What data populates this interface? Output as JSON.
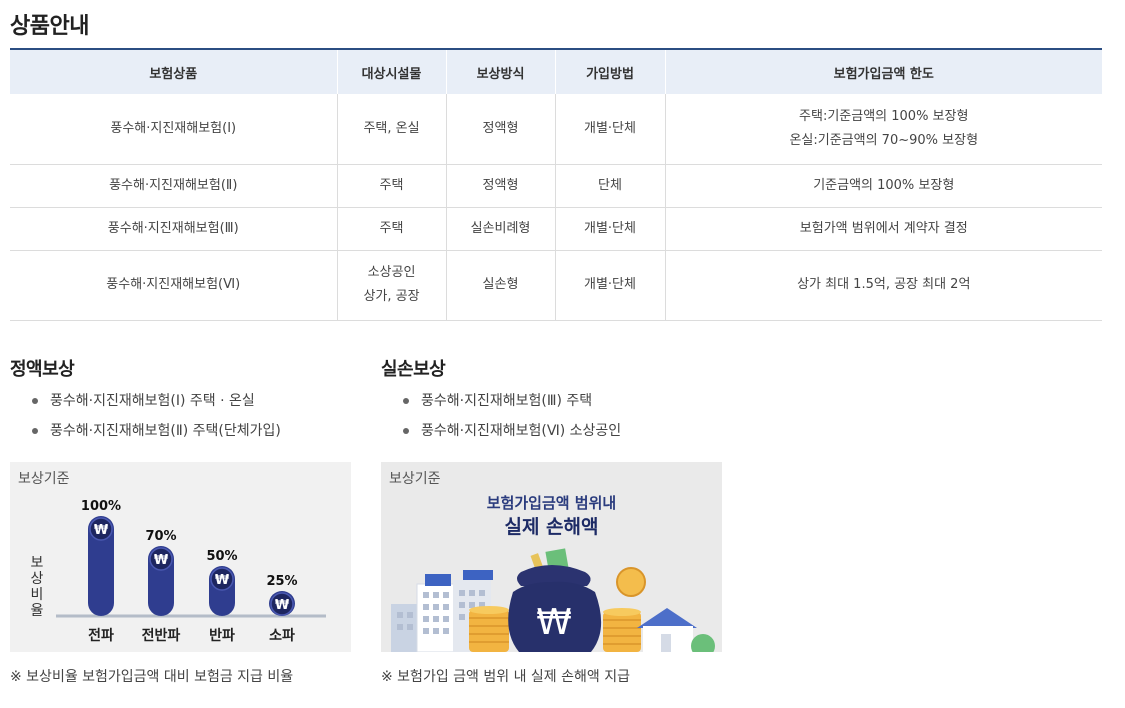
{
  "page": {
    "title": "상품안내"
  },
  "table": {
    "headers": [
      "보험상품",
      "대상시설물",
      "보상방식",
      "가입방법",
      "보험가입금액 한도"
    ],
    "rows": [
      {
        "product": "풍수해·지진재해보험(Ⅰ)",
        "facility": [
          "주택, 온실"
        ],
        "method": "정액형",
        "join": "개별·단체",
        "limit": [
          "주택:기준금액의 100% 보장형",
          "온실:기준금액의 70~90% 보장형"
        ]
      },
      {
        "product": "풍수해·지진재해보험(Ⅱ)",
        "facility": [
          "주택"
        ],
        "method": "정액형",
        "join": "단체",
        "limit": [
          "기준금액의 100% 보장형"
        ]
      },
      {
        "product": "풍수해·지진재해보험(Ⅲ)",
        "facility": [
          "주택"
        ],
        "method": "실손비례형",
        "join": "개별·단체",
        "limit": [
          "보험가액 범위에서 계약자 결정"
        ]
      },
      {
        "product": "풍수해·지진재해보험(Ⅵ)",
        "facility": [
          "소상공인",
          "상가, 공장"
        ],
        "method": "실손형",
        "join": "개별·단체",
        "limit": [
          "상가 최대 1.5억, 공장 최대 2억"
        ]
      }
    ]
  },
  "fixed": {
    "heading": "정액보상",
    "items": [
      "풍수해·지진재해보험(Ⅰ) 주택 · 온실",
      "풍수해·지진재해보험(Ⅱ) 주택(단체가입)"
    ],
    "panel_label": "보상기준",
    "footnote": "※ 보상비율 보험가입금액 대비 보험금 지급 비율",
    "currency_symbol": "₩"
  },
  "actual": {
    "heading": "실손보상",
    "items": [
      "풍수해·지진재해보험(Ⅲ) 주택",
      "풍수해·지진재해보험(Ⅵ) 소상공인"
    ],
    "panel_label": "보상기준",
    "title_line1": "보험가입금액 범위내",
    "title_line2": "실제 손해액",
    "bag_symbol": "₩",
    "footnote": "※ 보험가입 금액 범위 내 실제 손해액 지급"
  },
  "chart_data": {
    "type": "bar",
    "ylabel": "보상비율",
    "categories": [
      "전파",
      "전반파",
      "반파",
      "소파"
    ],
    "values": [
      100,
      70,
      50,
      25
    ],
    "value_labels": [
      "100%",
      "70%",
      "50%",
      "25%"
    ],
    "ylim": [
      0,
      100
    ],
    "grid": false,
    "bar_color": "#2f3d8f",
    "axis_color": "#b4bcc8"
  }
}
